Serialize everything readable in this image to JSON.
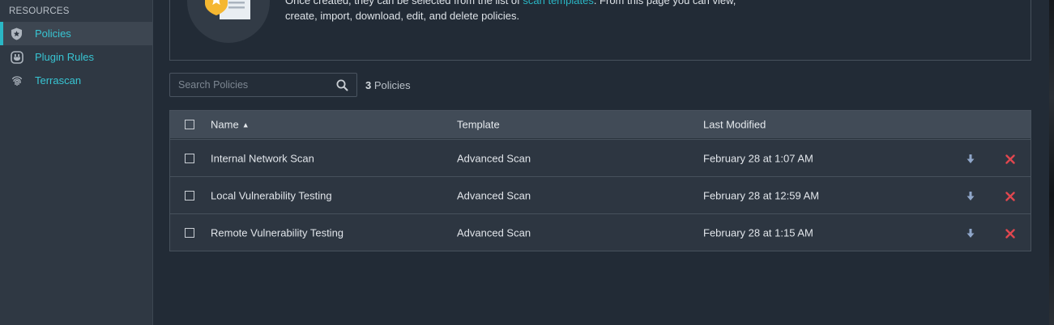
{
  "sidebar": {
    "heading": "RESOURCES",
    "items": [
      {
        "label": "Policies",
        "icon": "shield-star-icon",
        "active": true
      },
      {
        "label": "Plugin Rules",
        "icon": "plug-icon",
        "active": false
      },
      {
        "label": "Terrascan",
        "icon": "fingerprint-icon",
        "active": false
      }
    ]
  },
  "info": {
    "line1_before": "Once created, they can be selected from the list of ",
    "line1_link": "scan templates",
    "line1_after": ". From this page you can view,",
    "line2": "create, import, download, edit, and delete policies."
  },
  "search": {
    "placeholder": "Search Policies",
    "value": ""
  },
  "count": {
    "number": "3",
    "label": "Policies"
  },
  "table": {
    "columns": {
      "name": "Name",
      "template": "Template",
      "modified": "Last Modified"
    },
    "sort_indicator": "▲",
    "rows": [
      {
        "name": "Internal Network Scan",
        "template": "Advanced Scan",
        "modified": "February 28 at 1:07 AM"
      },
      {
        "name": "Local Vulnerability Testing",
        "template": "Advanced Scan",
        "modified": "February 28 at 12:59 AM"
      },
      {
        "name": "Remote Vulnerability Testing",
        "template": "Advanced Scan",
        "modified": "February 28 at 1:15 AM"
      }
    ]
  },
  "colors": {
    "accent": "#2ab7c5",
    "delete": "#e0474f",
    "download": "#8fa6c9"
  }
}
